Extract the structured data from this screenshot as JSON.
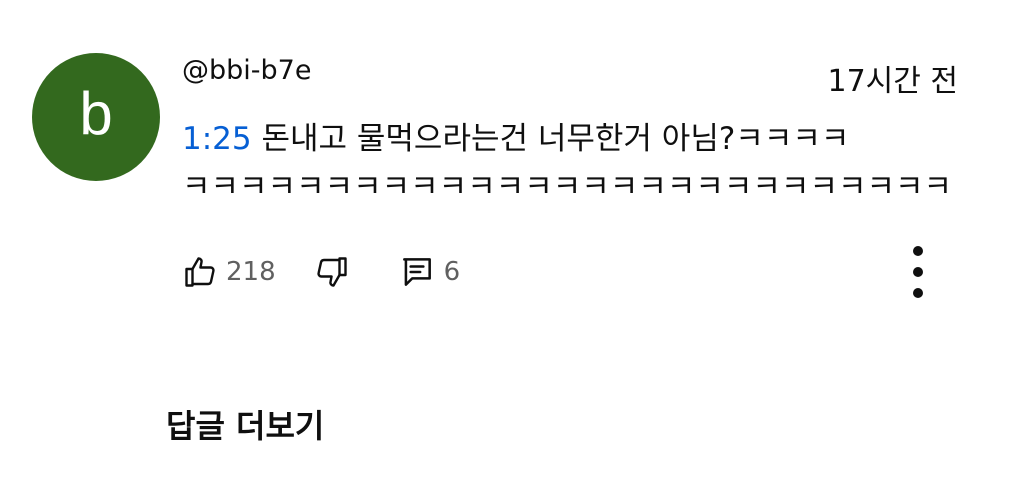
{
  "comment": {
    "avatar_letter": "b",
    "avatar_color": "#33691e",
    "author": "@bbi-b7e",
    "time_ago": "17시간 전",
    "timestamp_link": "1:25",
    "text_line1": " 돈내고 물먹으라는건 너무한거 아님?ㅋㅋㅋㅋ",
    "text_line2": "ㅋㅋㅋㅋㅋㅋㅋㅋㅋㅋㅋㅋㅋㅋㅋㅋㅋㅋㅋㅋㅋㅋㅋㅋㅋㅋㅋ",
    "link_color": "#065fd4"
  },
  "actions": {
    "like_icon": "thumbs-up-icon",
    "like_count": "218",
    "dislike_icon": "thumbs-down-icon",
    "reply_icon": "comment-icon",
    "reply_count": "6",
    "more_icon": "more-vertical-icon"
  },
  "more_replies_label": "답글 더보기"
}
